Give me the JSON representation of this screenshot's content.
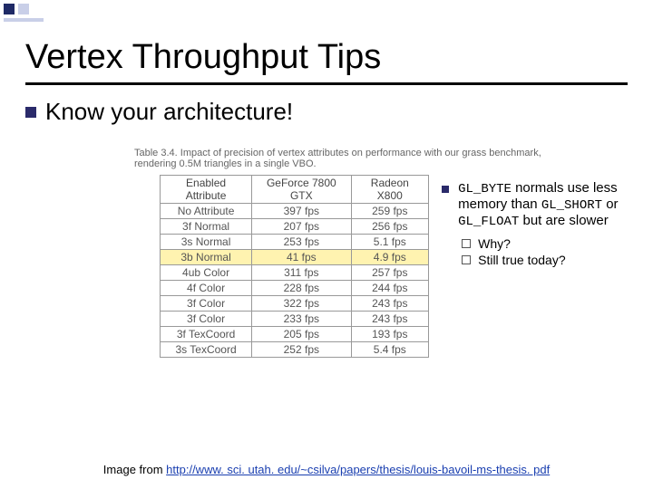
{
  "title": "Vertex Throughput Tips",
  "bullet1": "Know your architecture!",
  "table_caption": "Table 3.4. Impact of precision of vertex attributes on performance with our grass benchmark, rendering 0.5M triangles in a single VBO.",
  "table": {
    "headers": [
      "Enabled Attribute",
      "GeForce 7800 GTX",
      "Radeon X800"
    ],
    "rows": [
      {
        "cells": [
          "No Attribute",
          "397 fps",
          "259 fps"
        ],
        "highlight": false
      },
      {
        "cells": [
          "3f Normal",
          "207 fps",
          "256 fps"
        ],
        "highlight": false
      },
      {
        "cells": [
          "3s Normal",
          "253 fps",
          "5.1 fps"
        ],
        "highlight": false
      },
      {
        "cells": [
          "3b Normal",
          "41 fps",
          "4.9 fps"
        ],
        "highlight": true
      },
      {
        "cells": [
          "4ub Color",
          "311 fps",
          "257 fps"
        ],
        "highlight": false
      },
      {
        "cells": [
          "4f Color",
          "228 fps",
          "244 fps"
        ],
        "highlight": false
      },
      {
        "cells": [
          "3f Color",
          "322 fps",
          "243 fps"
        ],
        "highlight": false
      },
      {
        "cells": [
          "3f Color",
          "233 fps",
          "243 fps"
        ],
        "highlight": false
      },
      {
        "cells": [
          "3f TexCoord",
          "205 fps",
          "193 fps"
        ],
        "highlight": false
      },
      {
        "cells": [
          "3s TexCoord",
          "252 fps",
          "5.4 fps"
        ],
        "highlight": false
      }
    ]
  },
  "note": {
    "code1": "GL_BYTE",
    "text1": " normals use less memory than ",
    "code2": "GL_SHORT",
    "mid": " or ",
    "code3": "GL_FLOAT",
    "text2": " but are slower"
  },
  "sub_questions": [
    "Why?",
    "Still true today?"
  ],
  "footer_prefix": "Image from ",
  "footer_link": "http://www. sci. utah. edu/~csilva/papers/thesis/louis-bavoil-ms-thesis. pdf"
}
